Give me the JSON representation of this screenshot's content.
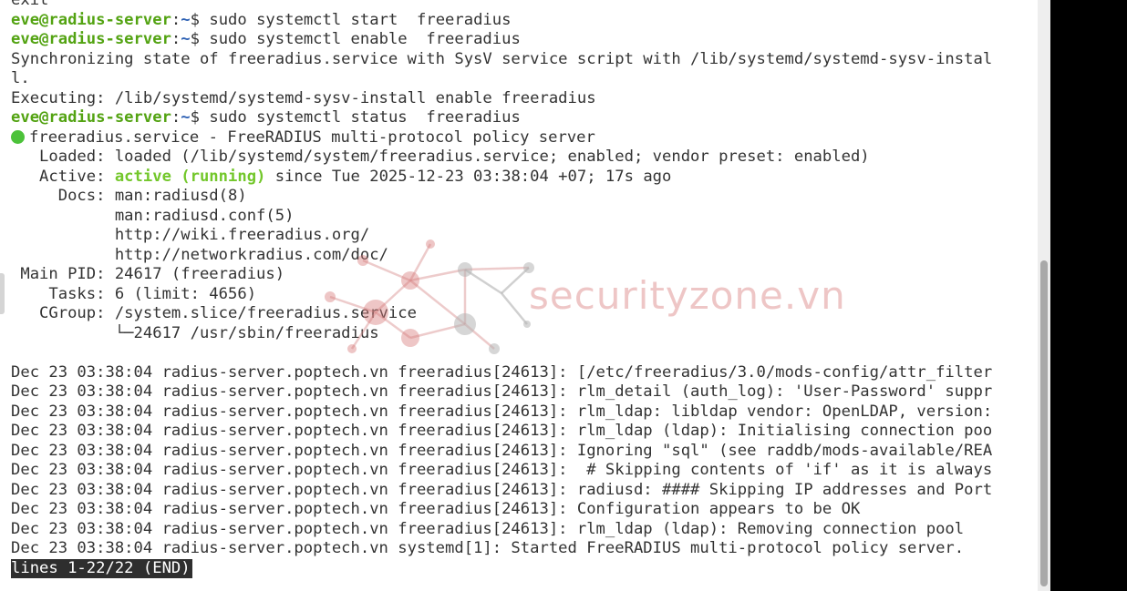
{
  "terminal": {
    "line0": "exit",
    "cmd1": {
      "user_host": "eve@radius-server",
      "sep": ":",
      "path": "~",
      "prompt_end": "$ ",
      "command": "sudo systemctl start  freeradius"
    },
    "cmd2": {
      "user_host": "eve@radius-server",
      "sep": ":",
      "path": "~",
      "prompt_end": "$ ",
      "command": "sudo systemctl enable  freeradius"
    },
    "sync_line1": "Synchronizing state of freeradius.service with SysV service script with /lib/systemd/systemd-sysv-instal",
    "sync_line2": "l.",
    "exec_line": "Executing: /lib/systemd/systemd-sysv-install enable freeradius",
    "cmd3": {
      "user_host": "eve@radius-server",
      "sep": ":",
      "path": "~",
      "prompt_end": "$ ",
      "command": "sudo systemctl status  freeradius"
    },
    "status": {
      "service_line": "freeradius.service - FreeRADIUS multi-protocol policy server",
      "loaded": "   Loaded: loaded (/lib/systemd/system/freeradius.service; enabled; vendor preset: enabled)",
      "active_label": "   Active: ",
      "active_state": "active (running)",
      "active_rest": " since Tue 2025-12-23 03:38:04 +07; 17s ago",
      "docs1": "     Docs: man:radiusd(8)",
      "docs2": "           man:radiusd.conf(5)",
      "docs3": "           http://wiki.freeradius.org/",
      "docs4": "           http://networkradius.com/doc/",
      "main_pid": " Main PID: 24617 (freeradius)",
      "tasks": "    Tasks: 6 (limit: 4656)",
      "cgroup": "   CGroup: /system.slice/freeradius.service",
      "cgroup_child": "           └─24617 /usr/sbin/freeradius"
    },
    "log_lines": [
      "Dec 23 03:38:04 radius-server.poptech.vn freeradius[24613]: [/etc/freeradius/3.0/mods-config/attr_filter",
      "Dec 23 03:38:04 radius-server.poptech.vn freeradius[24613]: rlm_detail (auth_log): 'User-Password' suppr",
      "Dec 23 03:38:04 radius-server.poptech.vn freeradius[24613]: rlm_ldap: libldap vendor: OpenLDAP, version:",
      "Dec 23 03:38:04 radius-server.poptech.vn freeradius[24613]: rlm_ldap (ldap): Initialising connection poo",
      "Dec 23 03:38:04 radius-server.poptech.vn freeradius[24613]: Ignoring \"sql\" (see raddb/mods-available/REA",
      "Dec 23 03:38:04 radius-server.poptech.vn freeradius[24613]:  # Skipping contents of 'if' as it is always",
      "Dec 23 03:38:04 radius-server.poptech.vn freeradius[24613]: radiusd: #### Skipping IP addresses and Port",
      "Dec 23 03:38:04 radius-server.poptech.vn freeradius[24613]: Configuration appears to be OK",
      "Dec 23 03:38:04 radius-server.poptech.vn freeradius[24613]: rlm_ldap (ldap): Removing connection pool",
      "Dec 23 03:38:04 radius-server.poptech.vn systemd[1]: Started FreeRADIUS multi-protocol policy server."
    ],
    "pager_status": "lines 1-22/22 (END)"
  },
  "watermark": {
    "text": "securityzone.vn"
  },
  "colors": {
    "prompt_user": "#53a312",
    "prompt_path": "#2b5fb3",
    "active_running": "#73c72b",
    "status_dot": "#4cc23a",
    "text": "#333333",
    "background": "#ffffff"
  },
  "icons": {
    "status": "green-dot-icon",
    "watermark_logo": "network-nodes-logo-icon"
  }
}
